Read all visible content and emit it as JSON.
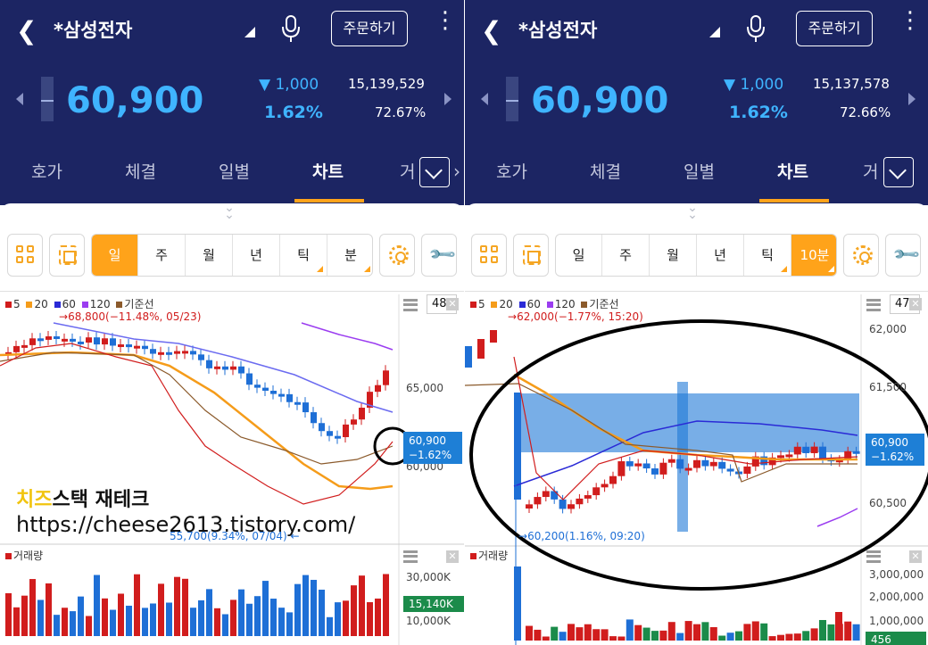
{
  "left": {
    "header": {
      "title": "*삼성전자",
      "order_button": "주문하기",
      "price": "60,900",
      "change": "▼ 1,000",
      "change_pct": "1.62%",
      "volume": "15,139,529",
      "volume_rate": "72.67%"
    },
    "tabs": [
      {
        "label": "호가"
      },
      {
        "label": "체결"
      },
      {
        "label": "일별"
      },
      {
        "label": "차트"
      },
      {
        "label": "거"
      }
    ],
    "active_tab": "차트",
    "periods": [
      {
        "label": "일"
      },
      {
        "label": "주"
      },
      {
        "label": "월"
      },
      {
        "label": "년"
      },
      {
        "label": "틱"
      },
      {
        "label": "분"
      }
    ],
    "active_period": "일",
    "legend": [
      {
        "label": "5",
        "color": "#d11d1d"
      },
      {
        "label": "20",
        "color": "#f59c1a"
      },
      {
        "label": "60",
        "color": "#2a2ad6"
      },
      {
        "label": "120",
        "color": "#9b3df0"
      },
      {
        "label": "기준선",
        "color": "#8b5a2b"
      }
    ],
    "count": "48",
    "high_note": "68,800(−11.48%, 05/23)",
    "low_note": "55,700(9.34%, 07/04)",
    "y_labels": [
      "65,000",
      "60,000"
    ],
    "current_tag": {
      "price": "60,900",
      "pct": "−1.62%"
    },
    "volume_title": "거래량",
    "volume_labels": [
      "30,000K",
      "10,000K"
    ],
    "volume_tag": "15,140K",
    "watermark_title_a": "치즈",
    "watermark_title_b": "스택 재테크",
    "watermark_url": "https://cheese2613.tistory.com/"
  },
  "right": {
    "header": {
      "title": "*삼성전자",
      "order_button": "주문하기",
      "price": "60,900",
      "change": "▼ 1,000",
      "change_pct": "1.62%",
      "volume": "15,137,578",
      "volume_rate": "72.66%"
    },
    "tabs": [
      {
        "label": "호가"
      },
      {
        "label": "체결"
      },
      {
        "label": "일별"
      },
      {
        "label": "차트"
      },
      {
        "label": "거"
      }
    ],
    "active_tab": "차트",
    "periods": [
      {
        "label": "일"
      },
      {
        "label": "주"
      },
      {
        "label": "월"
      },
      {
        "label": "년"
      },
      {
        "label": "틱"
      },
      {
        "label": "10분"
      }
    ],
    "active_period": "10분",
    "legend": [
      {
        "label": "5",
        "color": "#d11d1d"
      },
      {
        "label": "20",
        "color": "#f59c1a"
      },
      {
        "label": "60",
        "color": "#2a2ad6"
      },
      {
        "label": "120",
        "color": "#9b3df0"
      },
      {
        "label": "기준선",
        "color": "#8b5a2b"
      }
    ],
    "count": "47",
    "high_note": "62,000(−1.77%, 15:20)",
    "low_note": "60,200(1.16%, 09:20)",
    "y_labels": [
      "62,000",
      "61,500",
      "60,500"
    ],
    "current_tag": {
      "price": "60,900",
      "pct": "−1.62%"
    },
    "volume_title": "거래량",
    "volume_labels": [
      "3,000,000",
      "2,000,000",
      "1,000,000"
    ],
    "volume_tag": "456"
  },
  "colors": {
    "header_bg": "#1c2563",
    "accent": "#ffa31a",
    "up": "#d11d1d",
    "down": "#1e6fd6",
    "price": "#3fb4ff"
  }
}
